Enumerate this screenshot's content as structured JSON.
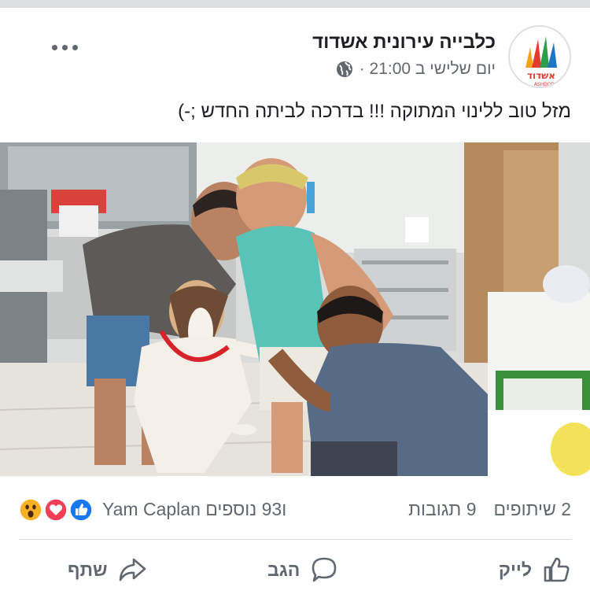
{
  "header": {
    "page_name": "כלבייה עירונית אשדוד",
    "timestamp": "יום שלישי ב 21:00 ·",
    "privacy_icon": "globe-icon",
    "logo_text": "אשדוד",
    "logo_subtext": "ASHDOD",
    "more_icon": "more-horizontal-icon"
  },
  "post": {
    "text": "מזל טוב ללינוי המתוקה !!! בדרכה לביתה החדש ;-)"
  },
  "reactions": {
    "names": "Yam Caplan ו93 נוספים",
    "icons": [
      "like-reaction-icon",
      "love-reaction-icon",
      "wow-reaction-icon"
    ],
    "comments": "9 תגובות",
    "shares": "2 שיתופים"
  },
  "actions": {
    "like": "לייק",
    "comment": "הגב",
    "share": "שתף"
  },
  "colors": {
    "facebook_blue": "#1877f2",
    "love_red": "#f33e58",
    "wow_yellow": "#f7b125",
    "secondary_text": "#606770"
  }
}
